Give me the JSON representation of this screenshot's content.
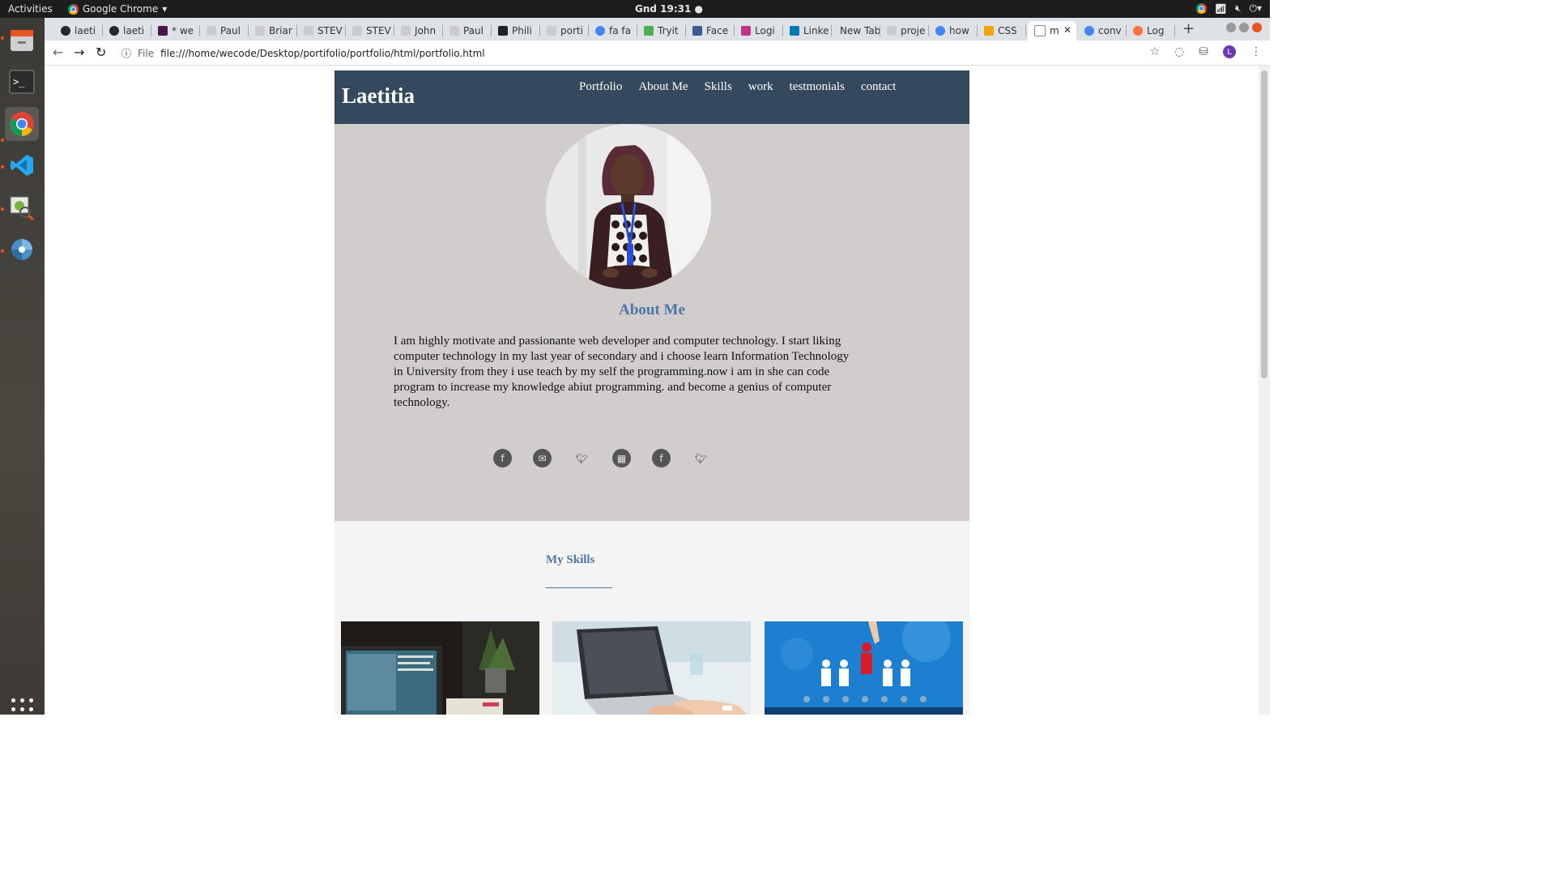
{
  "system": {
    "activities": "Activities",
    "app_name": "Google Chrome",
    "clock": "Gnd 19:31"
  },
  "browser": {
    "tabs": [
      {
        "label": "laeti"
      },
      {
        "label": "laeti"
      },
      {
        "label": "* we"
      },
      {
        "label": "Paul"
      },
      {
        "label": "Briar"
      },
      {
        "label": "STEV"
      },
      {
        "label": "STEV"
      },
      {
        "label": "John"
      },
      {
        "label": "Paul"
      },
      {
        "label": "Phili"
      },
      {
        "label": "porti"
      },
      {
        "label": "fa fa"
      },
      {
        "label": "Tryit"
      },
      {
        "label": "Face"
      },
      {
        "label": "Logi"
      },
      {
        "label": "Linke"
      },
      {
        "label": "New Tab"
      },
      {
        "label": "proje"
      },
      {
        "label": "how"
      },
      {
        "label": "CSS"
      },
      {
        "label": "m"
      },
      {
        "label": "conv"
      },
      {
        "label": "Log"
      }
    ],
    "url_scheme": "File",
    "url": "file:///home/wecode/Desktop/portifolio/portfolio/html/portfolio.html",
    "profile_initial": "L"
  },
  "page": {
    "brand": "Laetitia",
    "nav": [
      "Portfolio",
      "About Me",
      "Skills",
      "work",
      "testmonials",
      "contact"
    ],
    "about_title": "About Me",
    "about_text": "I am highly motivate and passionante web developer and computer technology. I start liking computer technology in my last year of secondary and i choose learn Information Technology in University from they i use teach by my self the programming.now i am in she can code program to increase my knowledge abiut programming. and become a genius of computer technology.",
    "socials": [
      "facebook-icon",
      "email-icon",
      "twitter-icon",
      "gmail-icon",
      "facebook-icon",
      "twitter-icon"
    ],
    "skills_title": "My Skills",
    "colors": {
      "header_bg": "#34495e",
      "hero_bg": "#d1cdcd",
      "accent": "#4b77a5",
      "skills_bg": "#f4f4f5"
    }
  }
}
